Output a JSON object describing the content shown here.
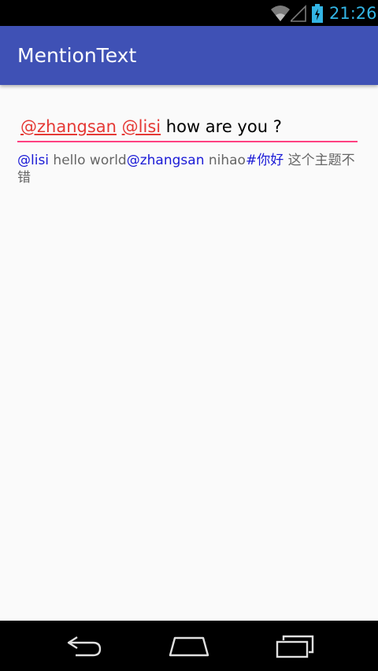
{
  "status_bar": {
    "time": "21:26",
    "icons": [
      "wifi-icon",
      "signal-icon",
      "battery-charging-icon"
    ],
    "clock_color": "#33b5e5"
  },
  "app_bar": {
    "title": "MentionText",
    "color": "#3f51b5"
  },
  "edit_field": {
    "mention_1": "@zhangsan",
    "space_1": " ",
    "mention_2": "@lisi",
    "plain_text": " how are you ?",
    "underline_color": "#ff4081",
    "mention_color": "#e53935"
  },
  "text_view": {
    "mention_1": "@lisi",
    "text_1": " hello world",
    "mention_2": "@zhangsan",
    "text_2": " nihao",
    "topic": "#你好",
    "text_3": " 这个主题不错",
    "mention_color": "#1a1ad6"
  },
  "nav_bar": {
    "buttons": [
      "back-icon",
      "home-icon",
      "recents-icon"
    ]
  }
}
